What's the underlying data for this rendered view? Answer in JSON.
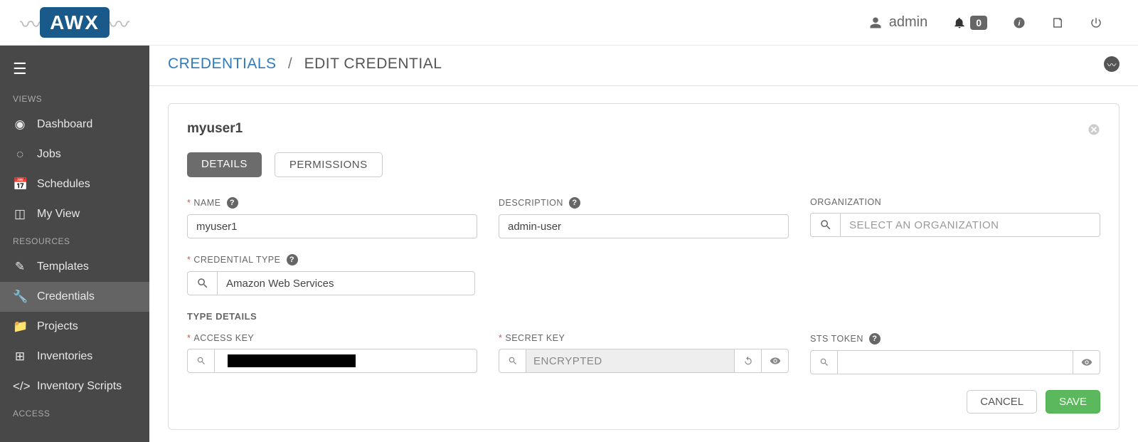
{
  "header": {
    "logo_text": "AWX",
    "user": "admin",
    "notif_count": "0"
  },
  "sidebar": {
    "sections": {
      "views": "VIEWS",
      "resources": "RESOURCES",
      "access": "ACCESS"
    },
    "items": {
      "dashboard": "Dashboard",
      "jobs": "Jobs",
      "schedules": "Schedules",
      "myview": "My View",
      "templates": "Templates",
      "credentials": "Credentials",
      "projects": "Projects",
      "inventories": "Inventories",
      "inventory_scripts": "Inventory Scripts"
    }
  },
  "breadcrumb": {
    "root": "CREDENTIALS",
    "sep": "/",
    "current": "EDIT CREDENTIAL"
  },
  "panel": {
    "title": "myuser1",
    "tabs": {
      "details": "DETAILS",
      "permissions": "PERMISSIONS"
    },
    "labels": {
      "name": "NAME",
      "description": "DESCRIPTION",
      "organization": "ORGANIZATION",
      "org_placeholder": "SELECT AN ORGANIZATION",
      "cred_type": "CREDENTIAL TYPE",
      "type_details": "TYPE DETAILS",
      "access_key": "ACCESS KEY",
      "secret_key": "SECRET KEY",
      "sts_token": "STS TOKEN",
      "encrypted": "ENCRYPTED"
    },
    "values": {
      "name": "myuser1",
      "description": "admin-user",
      "organization": "",
      "credential_type": "Amazon Web Services",
      "access_key": "",
      "sts_token": ""
    },
    "buttons": {
      "cancel": "CANCEL",
      "save": "SAVE"
    }
  }
}
